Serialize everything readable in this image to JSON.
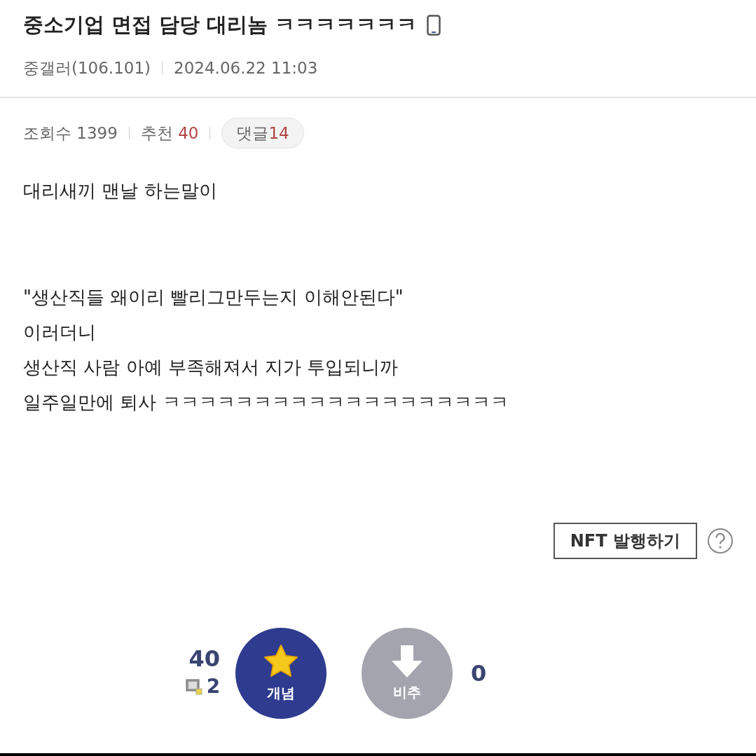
{
  "post": {
    "title": "중소기업 면접 담당 대리놈 ㅋㅋㅋㅋㅋㅋㅋ",
    "author": "중갤러(106.101)",
    "date": "2024.06.22 11:03"
  },
  "stats": {
    "views_label": "조회수",
    "views": "1399",
    "recommend_label": "추천",
    "recommend": "40",
    "comments_label": "댓글",
    "comments": "14"
  },
  "body": {
    "paragraphs": [
      [
        "대리새끼 맨날 하는말이"
      ],
      [
        "\"생산직들 왜이리 빨리그만두는지 이해안된다\"",
        "이러더니",
        "생산직 사람 아예 부족해져서 지가 투입되니까",
        "일주일만에 퇴사 ㅋㅋㅋㅋㅋㅋㅋㅋㅋㅋㅋㅋㅋㅋㅋㅋㅋㅋㅋ"
      ]
    ]
  },
  "nft_button": "NFT 발행하기",
  "vote": {
    "up_count": "40",
    "fix_count": "2",
    "up_label": "개념",
    "down_label": "비추",
    "down_count": "0"
  }
}
